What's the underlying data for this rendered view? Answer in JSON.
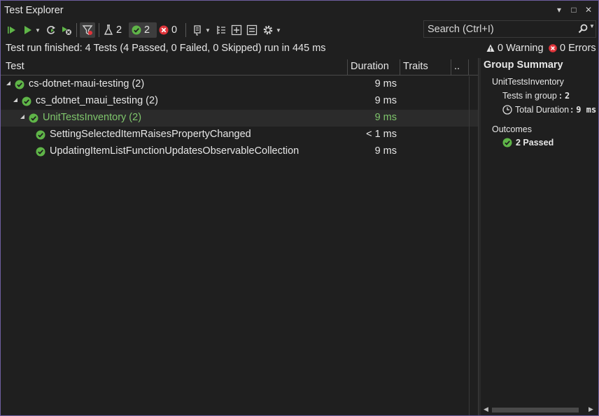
{
  "window": {
    "title": "Test Explorer",
    "controls": [
      "▾",
      "□",
      "✕"
    ]
  },
  "toolbar": {
    "total_count": "2",
    "passed_count": "2",
    "failed_count": "0"
  },
  "search": {
    "placeholder": "Search (Ctrl+I)"
  },
  "status": {
    "summary": "Test run finished: 4 Tests (4 Passed, 0 Failed, 0 Skipped) run in 445 ms",
    "warnings": "0 Warning",
    "errors": "0 Errors"
  },
  "grid": {
    "columns": [
      "Test",
      "Duration",
      "Traits",
      ".."
    ],
    "rows": [
      {
        "label": "cs-dotnet-maui-testing (2)",
        "duration": "9 ms"
      },
      {
        "label": "cs_dotnet_maui_testing (2)",
        "duration": "9 ms"
      },
      {
        "label": "UnitTestsInventory (2)",
        "duration": "9 ms"
      },
      {
        "label": "SettingSelectedItemRaisesPropertyChanged",
        "duration": "< 1 ms"
      },
      {
        "label": "UpdatingItemListFunctionUpdatesObservableCollection",
        "duration": "9 ms"
      }
    ]
  },
  "summary": {
    "title": "Group Summary",
    "group_name": "UnitTestsInventory",
    "tests_in_group_label": "Tests in group",
    "tests_in_group_value": "2",
    "total_duration_label": "Total Duration",
    "total_duration_value": "9 ms",
    "outcomes_label": "Outcomes",
    "passed": "2 Passed"
  },
  "colors": {
    "pass": "#5fb548",
    "fail": "#e0343a",
    "group_text": "#7fc66c",
    "border": "#6f5ea0"
  }
}
